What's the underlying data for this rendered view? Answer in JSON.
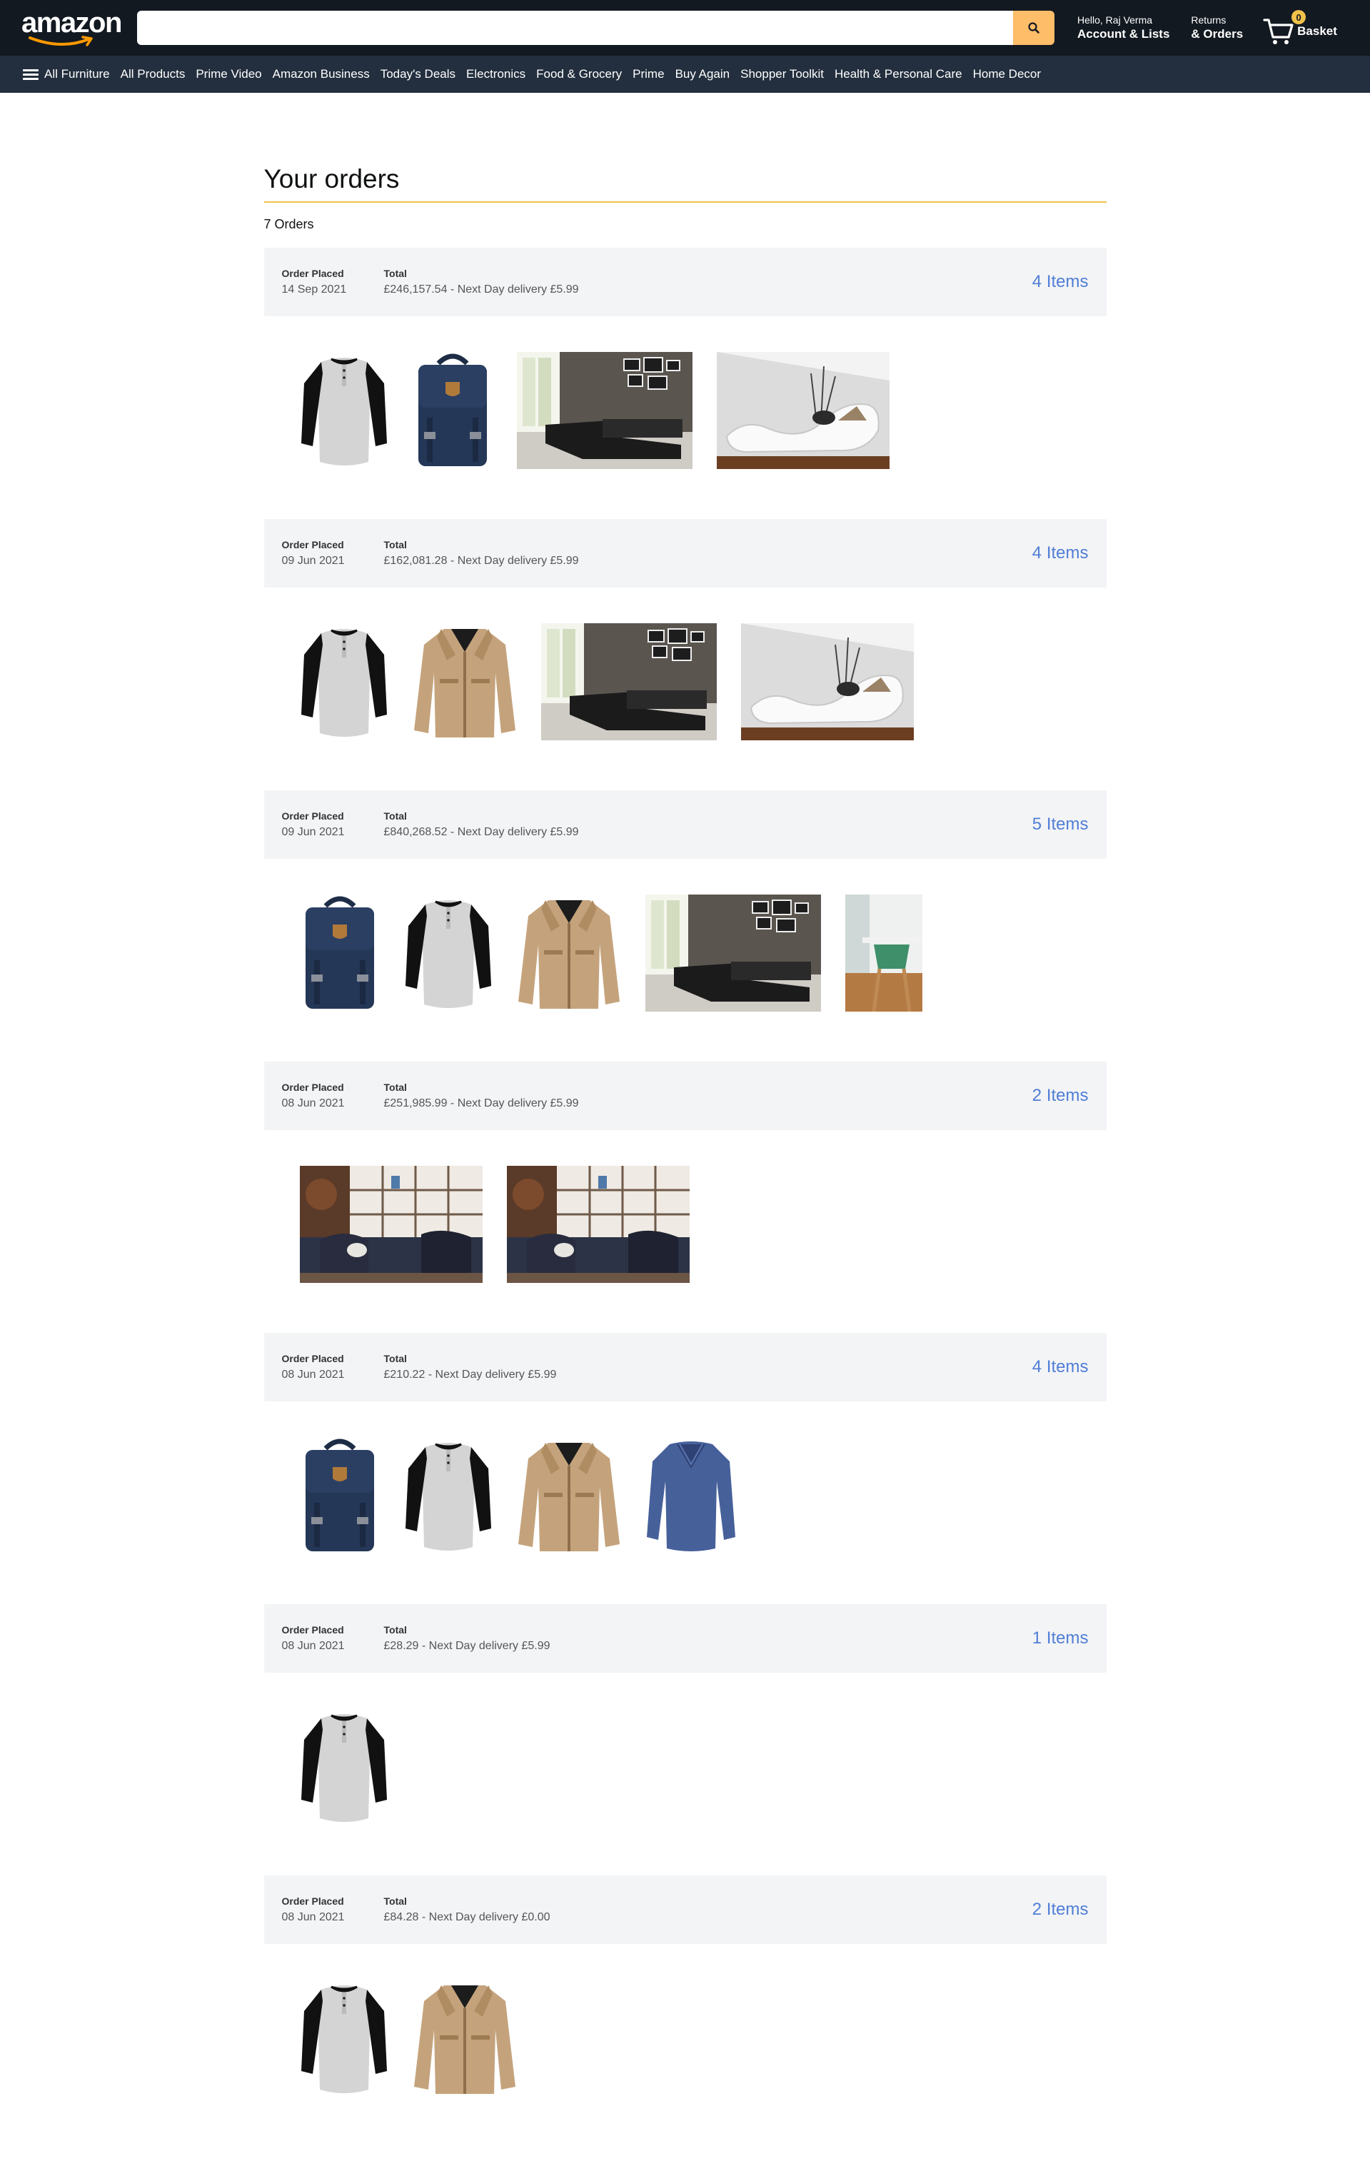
{
  "header": {
    "logo_text": "amazon",
    "search_placeholder": "",
    "account_line1": "Hello, Raj Verma",
    "account_line2": "Account & Lists",
    "returns_line1": "Returns",
    "returns_line2": "& Orders",
    "basket_count": "0",
    "basket_label": "Basket",
    "search_button_color": "#febd69"
  },
  "nav": [
    "All Furniture",
    "All Products",
    "Prime Video",
    "Amazon Business",
    "Today's Deals",
    "Electronics",
    "Food & Grocery",
    "Prime",
    "Buy Again",
    "Shopper Toolkit",
    "Health & Personal Care",
    "Home Decor"
  ],
  "page": {
    "title": "Your orders",
    "count": "7 Orders",
    "accent_color": "#f0c14b",
    "link_color": "#4f7ed6"
  },
  "labels": {
    "placed": "Order Placed",
    "total": "Total"
  },
  "orders": [
    {
      "date": "14 Sep 2021",
      "total": "£246,157.54 - Next Day delivery £5.99",
      "items_label": "4 Items",
      "products": [
        "raglan-shirt",
        "backpack",
        "sectional-sofa",
        "white-lounge-chair"
      ]
    },
    {
      "date": "09 Jun 2021",
      "total": "£162,081.28 - Next Day delivery £5.99",
      "items_label": "4 Items",
      "products": [
        "raglan-shirt",
        "tan-jacket",
        "sectional-sofa",
        "white-lounge-chair"
      ]
    },
    {
      "date": "09 Jun 2021",
      "total": "£840,268.52 - Next Day delivery £5.99",
      "items_label": "5 Items",
      "products": [
        "backpack",
        "raglan-shirt",
        "tan-jacket",
        "sectional-sofa",
        "dining-chair"
      ]
    },
    {
      "date": "08 Jun 2021",
      "total": "£251,985.99 - Next Day delivery £5.99",
      "items_label": "2 Items",
      "products": [
        "shelving-room",
        "shelving-room"
      ]
    },
    {
      "date": "08 Jun 2021",
      "total": "£210.22 - Next Day delivery £5.99",
      "items_label": "4 Items",
      "products": [
        "backpack",
        "raglan-shirt",
        "tan-jacket",
        "blue-sweater"
      ]
    },
    {
      "date": "08 Jun 2021",
      "total": "£28.29 - Next Day delivery £5.99",
      "items_label": "1 Items",
      "products": [
        "raglan-shirt"
      ]
    },
    {
      "date": "08 Jun 2021",
      "total": "£84.28 - Next Day delivery £0.00",
      "items_label": "2 Items",
      "products": [
        "raglan-shirt",
        "tan-jacket"
      ]
    }
  ]
}
